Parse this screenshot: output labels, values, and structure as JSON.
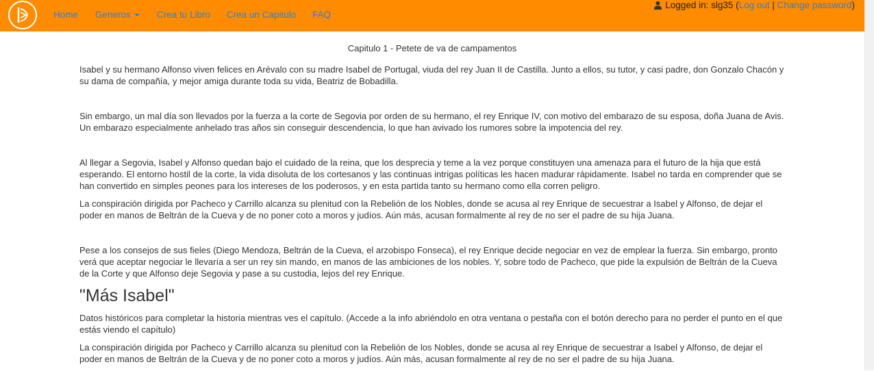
{
  "nav": {
    "logo_icon": "book-logo-icon",
    "items": [
      "Home",
      "Generos",
      "Crea tu Libro",
      "Crea un Capitulo",
      "FAQ"
    ],
    "user": {
      "logged_in_prefix": "Logged in: slg35 (",
      "logout_label": "Log out",
      "separator": " | ",
      "change_password_label": "Change password",
      "suffix": ")"
    }
  },
  "chapter": {
    "title": "Capitulo 1 - Petete de va de campamentos",
    "paragraphs": [
      "Isabel y su hermano Alfonso viven felices en Arévalo con su madre Isabel de Portugal, viuda del rey Juan II de Castilla. Junto a ellos, su tutor, y casi padre, don Gonzalo Chacón y su dama de compañía, y mejor amiga durante toda su vida, Beatriz de Bobadilla.",
      "Sin embargo, un mal día son llevados por la fuerza a la corte de Segovia por orden de su hermano, el rey Enrique IV, con motivo del embarazo de su esposa, doña Juana de Avis. Un embarazo especialmente anhelado tras años sin conseguir descendencia, lo que han avivado los rumores sobre la impotencia del rey.",
      "Al llegar a Segovia, Isabel y Alfonso quedan bajo el cuidado de la reina, que los desprecia y teme a la vez porque constituyen una amenaza para el futuro de la hija que está esperando. El entorno hostil de la corte, la vida disoluta de los cortesanos y las continuas intrigas políticas les hacen madurar rápidamente. Isabel no tarda en comprender que se han convertido en simples peones para los intereses de los poderosos, y en esta partida tanto su hermano como ella corren peligro.",
      "La conspiración dirigida por Pacheco y Carrillo alcanza su plenitud con la Rebelión de los Nobles, donde se acusa al rey Enrique de secuestrar a Isabel y Alfonso, de dejar el poder en manos de Beltrán de la Cueva y de no poner coto a moros y judíos. Aún más, acusan formalmente al rey de no ser el padre de su hija Juana.",
      "Pese a los consejos de sus fieles (Diego Mendoza, Beltrán de la Cueva, el arzobispo Fonseca), el rey Enrique decide negociar en vez de emplear la fuerza. Sin embargo, pronto verá que aceptar negociar le llevaría a ser un rey sin mando, en manos de las ambiciones de los nobles. Y, sobre todo de Pacheco, que pide la expulsión de Beltrán de la Cueva de la Corte y que Alfonso deje Segovia y pase a su custodia, lejos del rey Enrique."
    ]
  },
  "extra": {
    "heading": "\"Más Isabel\"",
    "intro": "Datos históricos para completar la historia mientras ves el capítulo. (Accede a la info abriéndolo en otra ventana o pestaña con el botón derecho para no perder el punto en el que estás viendo el capítulo)",
    "paragraph": "La conspiración dirigida por Pacheco y Carrillo alcanza su plenitud con la Rebelión de los Nobles, donde se acusa al rey Enrique de secuestrar a Isabel y Alfonso, de dejar el poder en manos de Beltrán de la Cueva y de no poner coto a moros y judíos. Aún más, acusan formalmente al rey de no ser el padre de su hija Juana."
  }
}
